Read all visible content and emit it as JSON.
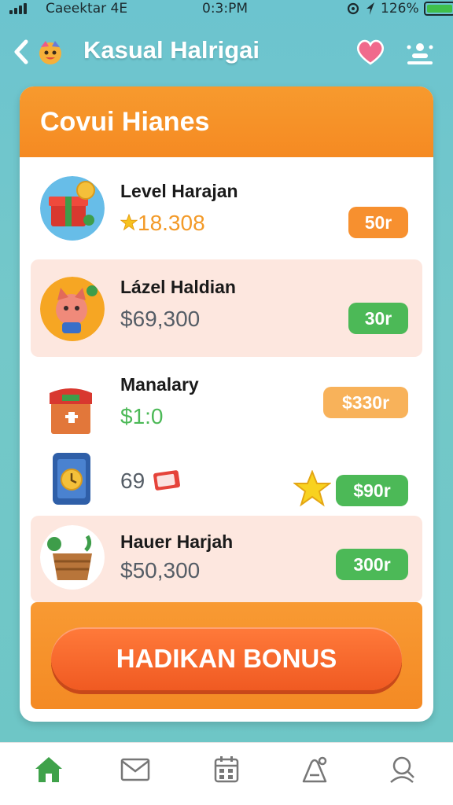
{
  "status_bar": {
    "carrier": "Caeektar  4E",
    "time": "0:3:PM",
    "battery": "126%",
    "battery_level": 1.0
  },
  "header": {
    "title": "Kasual Halrigai"
  },
  "card": {
    "title": "Covui Hianes",
    "items": [
      {
        "name": "Level Harajan",
        "value": "18.308",
        "value_prefix_icon": "star-icon",
        "button": "50r",
        "icon": "gift-box-icon",
        "highlight": false
      },
      {
        "name": "Lázel Haldian",
        "value": "$69,300",
        "button": "30r",
        "icon": "fox-character-icon",
        "highlight": true
      },
      {
        "name": "Manalary",
        "value": "$1:0",
        "button": "$330r",
        "icon": "treasure-chest-icon",
        "highlight": false
      },
      {
        "name": "",
        "value": "69",
        "value_suffix_icon": "ticket-icon",
        "button": "$90r",
        "icon": "smartphone-icon",
        "badge_icon": "star-icon",
        "highlight": false
      },
      {
        "name": "Hauer Harjah",
        "value": "$50,300",
        "button": "300r",
        "icon": "basket-icon",
        "highlight": true
      }
    ],
    "bonus_button": "HADIKAN BONUS"
  },
  "bottom_nav": [
    {
      "icon": "home-icon",
      "active": true
    },
    {
      "icon": "mail-icon",
      "active": false
    },
    {
      "icon": "calendar-icon",
      "active": false
    },
    {
      "icon": "rocket-icon",
      "active": false
    },
    {
      "icon": "profile-icon",
      "active": false
    }
  ],
  "colors": {
    "background": "#6cc4cf",
    "accent_orange": "#f58a22",
    "green": "#4cb957",
    "active_nav": "#3fa24a"
  }
}
